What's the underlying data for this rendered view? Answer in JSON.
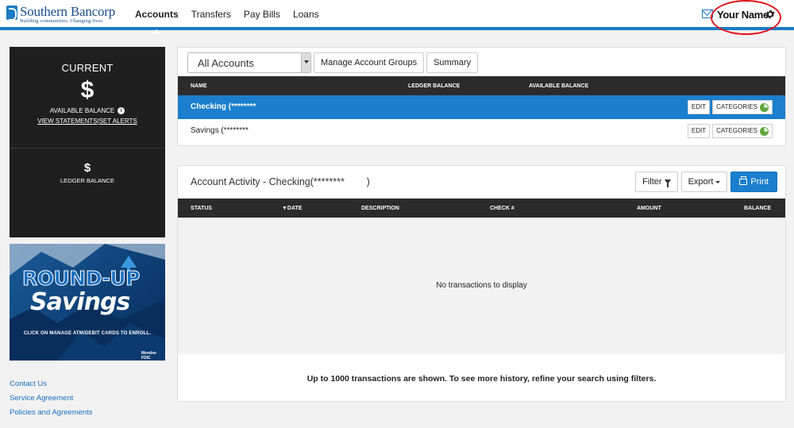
{
  "brand": {
    "name": "Southern Bancorp",
    "tagline": "Building communities. Changing lives."
  },
  "nav": {
    "items": [
      {
        "label": "Accounts",
        "active": true
      },
      {
        "label": "Transfers",
        "active": false
      },
      {
        "label": "Pay Bills",
        "active": false
      },
      {
        "label": "Loans",
        "active": false
      }
    ]
  },
  "header": {
    "user_name": "Your Name",
    "icons": [
      "mail-icon",
      "gear-icon"
    ]
  },
  "balance_card": {
    "title": "CURRENT",
    "available_amount": "$",
    "available_label": "AVAILABLE BALANCE",
    "view_statements": "VIEW STATEMENTS",
    "separator": "|",
    "set_alerts": "SET ALERTS",
    "ledger_amount": "$",
    "ledger_label": "LEDGER BALANCE"
  },
  "promo": {
    "line1": "ROUND-UP",
    "line2": "Savings",
    "sub": "CLICK ON MANAGE ATM/DEBIT CARDS TO ENROLL.",
    "fdic": "Member FDIC"
  },
  "footer_links": [
    "Contact Us",
    "Service Agreement",
    "Policies and Agreements"
  ],
  "accounts": {
    "select_value": "All Accounts",
    "manage_groups": "Manage Account Groups",
    "summary": "Summary",
    "columns": {
      "name": "NAME",
      "ledger": "LEDGER BALANCE",
      "available": "AVAILABLE BALANCE"
    },
    "rows": [
      {
        "name": "Checking (********",
        "selected": true,
        "edit": "EDIT",
        "categories": "CATEGORIES"
      },
      {
        "name": "Savings (********",
        "selected": false,
        "edit": "EDIT",
        "categories": "CATEGORIES"
      }
    ]
  },
  "activity": {
    "title": "Account Activity - Checking(********        )",
    "filter": "Filter",
    "export": "Export",
    "print": "Print",
    "columns": {
      "status": "STATUS",
      "date": "▼DATE",
      "description": "DESCRIPTION",
      "check": "CHECK #",
      "amount": "AMOUNT",
      "balance": "BALANCE"
    },
    "empty": "No transactions to display",
    "footer": "Up to 1000 transactions are shown. To see more history, refine your search using filters."
  },
  "colors": {
    "accent": "#1a7bc4",
    "selected_row": "#1a7fce",
    "header_dark": "#2b2b2b",
    "annotation_red": "#e0141b",
    "link": "#1a6fc0"
  }
}
